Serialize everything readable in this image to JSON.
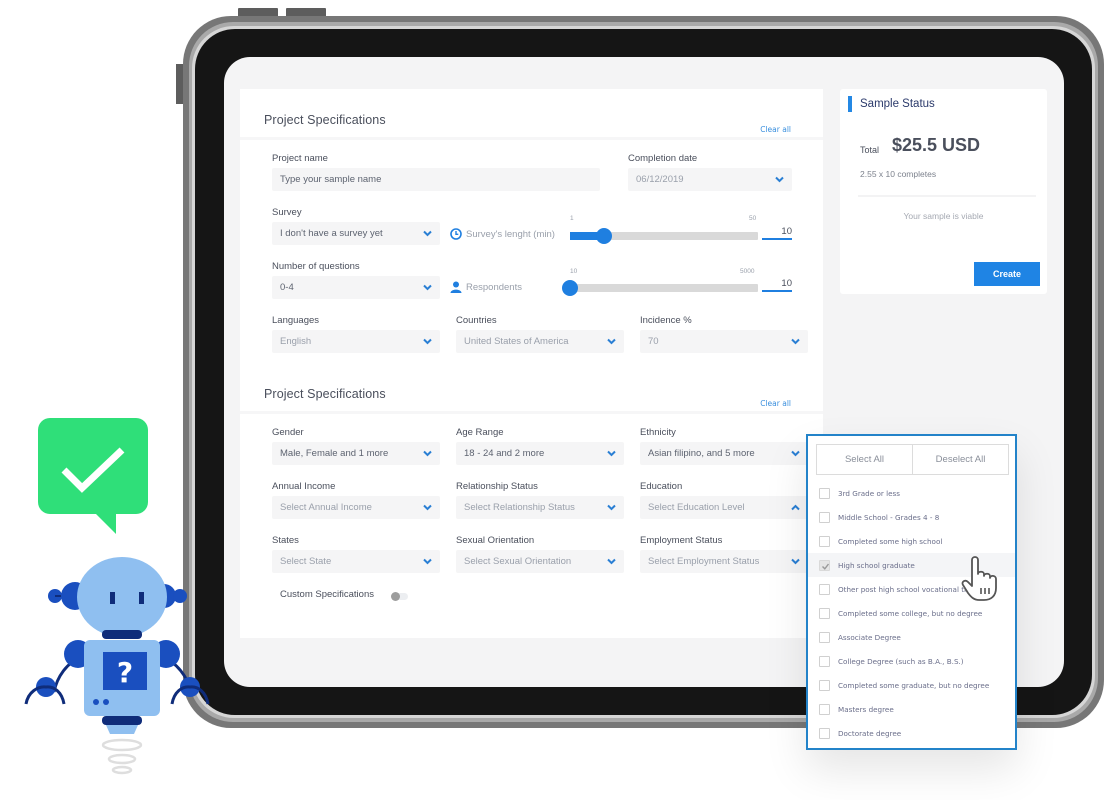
{
  "project_specs": {
    "title": "Project Specifications",
    "clear_all": "Clear all",
    "project_name": {
      "label": "Project name",
      "placeholder": "Type your sample name"
    },
    "completion_date": {
      "label": "Completion date",
      "value": "06/12/2019"
    },
    "survey": {
      "label": "Survey",
      "value": "I don't have a survey yet"
    },
    "survey_length": {
      "label": "Survey's lenght (min)",
      "min": "1",
      "max": "50",
      "value": "10",
      "fraction": 0.18
    },
    "num_questions": {
      "label": "Number of questions",
      "value": "0-4"
    },
    "respondents": {
      "label": "Respondents",
      "min": "10",
      "max": "5000",
      "value": "10",
      "fraction": 0.0
    },
    "languages": {
      "label": "Languages",
      "value": "English"
    },
    "countries": {
      "label": "Countries",
      "value": "United States of America"
    },
    "incidence": {
      "label": "Incidence %",
      "value": "70"
    }
  },
  "targeting": {
    "title": "Project Specifications",
    "clear_all": "Clear all",
    "gender": {
      "label": "Gender",
      "value": "Male, Female and 1 more"
    },
    "age_range": {
      "label": "Age Range",
      "value": "18 - 24 and 2 more"
    },
    "ethnicity": {
      "label": "Ethnicity",
      "value": "Asian filipino, and 5 more"
    },
    "annual_income": {
      "label": "Annual Income",
      "value": "Select Annual Income"
    },
    "relationship": {
      "label": "Relationship Status",
      "value": "Select Relationship Status"
    },
    "education": {
      "label": "Education",
      "value": "Select Education Level"
    },
    "states": {
      "label": "States",
      "value": "Select State"
    },
    "sexual_orientation": {
      "label": "Sexual Orientation",
      "value": "Select Sexual Orientation"
    },
    "employment": {
      "label": "Employment Status",
      "value": "Select Employment Status"
    },
    "custom_specs": {
      "label": "Custom Specifications",
      "enabled": false
    }
  },
  "sample_status": {
    "title": "Sample Status",
    "total_label": "Total",
    "total_value": "$25.5 USD",
    "completes": "2.55 x 10 completes",
    "message": "Your sample is viable",
    "create_label": "Create"
  },
  "education_dropdown": {
    "select_all": "Select All",
    "deselect_all": "Deselect All",
    "options": [
      {
        "label": "3rd Grade or less",
        "checked": false
      },
      {
        "label": "Middle School - Grades 4 - 8",
        "checked": false
      },
      {
        "label": "Completed some high school",
        "checked": false
      },
      {
        "label": "High school graduate",
        "checked": true
      },
      {
        "label": "Other post high school vocational training",
        "checked": false
      },
      {
        "label": "Completed some college, but no degree",
        "checked": false
      },
      {
        "label": "Associate Degree",
        "checked": false
      },
      {
        "label": "College Degree (such as B.A., B.S.)",
        "checked": false
      },
      {
        "label": "Completed some graduate, but no degree",
        "checked": false
      },
      {
        "label": "Masters degree",
        "checked": false
      },
      {
        "label": "Doctorate degree",
        "checked": false
      }
    ]
  },
  "colors": {
    "accent": "#1f7fe0",
    "success": "#2fdf79",
    "robot_light": "#8fbff0",
    "robot_dark": "#1a4fbf"
  }
}
